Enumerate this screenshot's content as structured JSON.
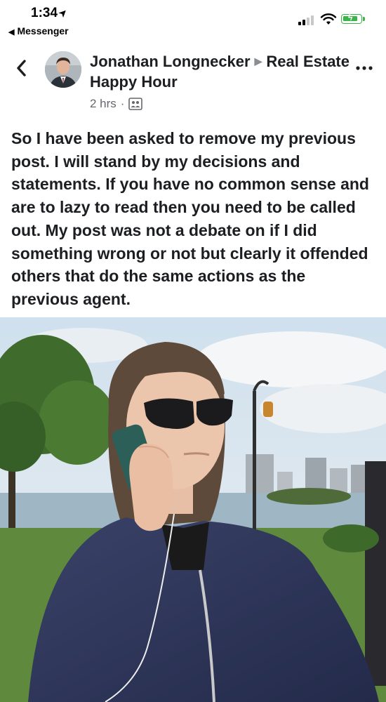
{
  "status_bar": {
    "time": "1:34",
    "back_app_label": "Messenger"
  },
  "post": {
    "author": "Jonathan Longnecker",
    "group": "Real Estate Happy Hour",
    "time_ago": "2 hrs",
    "audience_icon": "group-icon",
    "text": "So I have been asked to remove my previous post. I will stand by my decisions and statements. If you have no common sense and are to lazy to read then you need to be called out. My post was not a debate on if I did something wrong or not but clearly it offended others that do the same actions as the previous agent."
  },
  "colors": {
    "battery": "#3bb54a",
    "text_primary": "#1c1e21",
    "text_secondary": "#65676b"
  }
}
